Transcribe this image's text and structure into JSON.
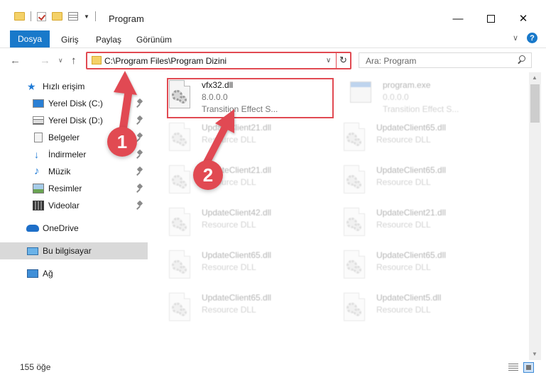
{
  "window": {
    "title": "Program",
    "min": "—",
    "close": "✕"
  },
  "ribbon": {
    "tabs": [
      "Dosya",
      "Giriş",
      "Paylaş",
      "Görünüm"
    ],
    "chevron": "∨",
    "help": "?"
  },
  "navigation": {
    "back": "←",
    "forward": "→",
    "recent": "∨",
    "up": "↑"
  },
  "address": {
    "path": "C:\\Program Files\\Program Dizini",
    "dropdown": "∨",
    "refresh": "↻"
  },
  "search": {
    "placeholder": "Ara: Program"
  },
  "sidebar": {
    "items": [
      {
        "label": "Hızlı erişim",
        "icon": "star-icon",
        "pinned": false
      },
      {
        "label": "Yerel Disk (C:)",
        "icon": "drive-icon",
        "pinned": true
      },
      {
        "label": "Yerel Disk (D:)",
        "icon": "drive-icon",
        "pinned": true
      },
      {
        "label": "Belgeler",
        "icon": "documents-icon",
        "pinned": true
      },
      {
        "label": "İndirmeler",
        "icon": "downloads-icon",
        "pinned": true
      },
      {
        "label": "Müzik",
        "icon": "music-icon",
        "pinned": true
      },
      {
        "label": "Resimler",
        "icon": "pictures-icon",
        "pinned": true
      },
      {
        "label": "Videolar",
        "icon": "videos-icon",
        "pinned": true
      },
      {
        "label": "OneDrive",
        "icon": "onedrive-icon",
        "pinned": false
      },
      {
        "label": "Bu bilgisayar",
        "icon": "this-pc-icon",
        "pinned": false,
        "selected": true
      },
      {
        "label": "Ağ",
        "icon": "network-icon",
        "pinned": false
      }
    ]
  },
  "files": [
    {
      "name": "vfx32.dll",
      "line2": "8.0.0.0",
      "line3": "Transition Effect S...",
      "type": "dll",
      "highlighted": true
    },
    {
      "name": "program.exe",
      "line2": "0.0.0.0",
      "line3": "Transition Effect S...",
      "type": "exe"
    },
    {
      "name": "UpdateClient21.dll",
      "line2": "Resource DLL",
      "type": "dll"
    },
    {
      "name": "UpdateClient65.dll",
      "line2": "Resource DLL",
      "type": "dll"
    },
    {
      "name": "UpdateClient21.dll",
      "line2": "Resource DLL",
      "type": "dll"
    },
    {
      "name": "UpdateClient65.dll",
      "line2": "Resource DLL",
      "type": "dll"
    },
    {
      "name": "UpdateClient42.dll",
      "line2": "Resource DLL",
      "type": "dll"
    },
    {
      "name": "UpdateClient21.dll",
      "line2": "Resource DLL",
      "type": "dll"
    },
    {
      "name": "UpdateClient65.dll",
      "line2": "Resource DLL",
      "type": "dll"
    },
    {
      "name": "UpdateClient65.dll",
      "line2": "Resource DLL",
      "type": "dll"
    },
    {
      "name": "UpdateClient65.dll",
      "line2": "Resource DLL",
      "type": "dll"
    },
    {
      "name": "UpdateClient5.dll",
      "line2": "Resource DLL",
      "type": "dll"
    }
  ],
  "status": {
    "count": "155 öğe"
  },
  "callouts": [
    "1",
    "2"
  ],
  "colors": {
    "accent": "#1979ca",
    "annotation": "#e14a52"
  }
}
